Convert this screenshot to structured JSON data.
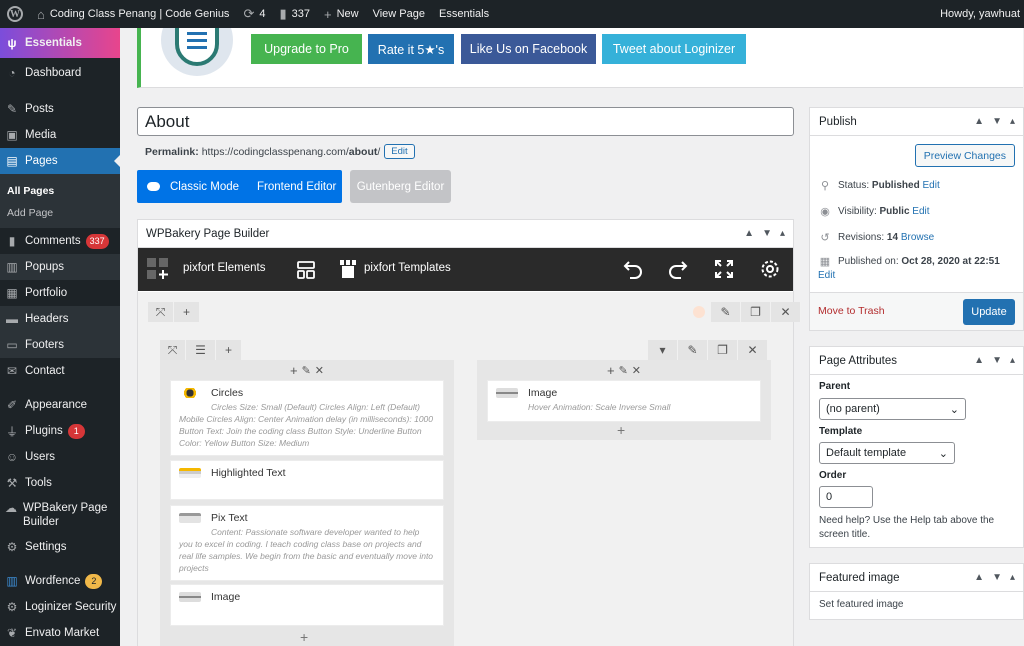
{
  "adminbar": {
    "site_name": "Coding Class Penang | Code Genius",
    "updates_count": "4",
    "comments_count": "337",
    "new_label": "New",
    "view_page_label": "View Page",
    "essentials_label": "Essentials",
    "howdy": "Howdy, yawhuat"
  },
  "sidebar": {
    "essentials": "Essentials",
    "dashboard": "Dashboard",
    "posts": "Posts",
    "media": "Media",
    "pages": "Pages",
    "all_pages": "All Pages",
    "add_page": "Add Page",
    "comments": "Comments",
    "comments_badge": "337",
    "popups": "Popups",
    "portfolio": "Portfolio",
    "headers": "Headers",
    "footers": "Footers",
    "contact": "Contact",
    "appearance": "Appearance",
    "plugins": "Plugins",
    "plugins_badge": "1",
    "users": "Users",
    "tools": "Tools",
    "wpbakery": "WPBakery Page Builder",
    "settings": "Settings",
    "wordfence": "Wordfence",
    "wordfence_badge": "2",
    "loginizer": "Loginizer Security",
    "envato": "Envato Market"
  },
  "promo": {
    "upgrade": "Upgrade to Pro",
    "rate": "Rate it 5★'s",
    "like": "Like Us on Facebook",
    "tweet": "Tweet about Loginizer"
  },
  "editor": {
    "title": "About",
    "permalink_label": "Permalink:",
    "permalink_base": "https://codingclasspenang.com/",
    "permalink_slug": "about",
    "permalink_tail": "/",
    "permalink_edit": "Edit",
    "classic_mode": "Classic Mode",
    "frontend_editor": "Frontend Editor",
    "gutenberg_editor": "Gutenberg Editor"
  },
  "wpbakery": {
    "title": "WPBakery Page Builder",
    "pixfort_elements": "pixfort Elements",
    "pixfort_templates": "pixfort Templates",
    "elements": [
      {
        "name": "Circles",
        "desc": "Circles Size: Small (Default)  Circles Align: Left (Default)  Mobile Circles Align: Center  Animation delay (in milliseconds): 1000  Button Text: Join the coding class  Button Style: Underline  Button Color: Yellow  Button Size: Medium"
      },
      {
        "name": "Highlighted Text",
        "desc": ""
      },
      {
        "name": "Pix Text",
        "desc": "Content: Passionate software developer wanted to help you to excel in coding. I teach coding class base on projects and real life samples. We begin from the basic and eventually move into projects"
      },
      {
        "name": "Image",
        "desc": ""
      },
      {
        "name": "Image",
        "desc": "Hover Animation: Scale Inverse Small"
      }
    ]
  },
  "publish": {
    "title": "Publish",
    "preview": "Preview Changes",
    "status_label": "Status:",
    "status_value": "Published",
    "visibility_label": "Visibility:",
    "visibility_value": "Public",
    "revisions_label": "Revisions:",
    "revisions_value": "14",
    "browse": "Browse",
    "published_on_label": "Published on:",
    "published_on_value": "Oct 28, 2020 at 22:51",
    "edit": "Edit",
    "trash": "Move to Trash",
    "update": "Update"
  },
  "page_attributes": {
    "title": "Page Attributes",
    "parent_label": "Parent",
    "parent_value": "(no parent)",
    "template_label": "Template",
    "template_value": "Default template",
    "order_label": "Order",
    "order_value": "0",
    "help_text": "Need help? Use the Help tab above the screen title."
  },
  "featured_image": {
    "title": "Featured image",
    "link": "Set featured image"
  },
  "colors": {
    "wp_blue": "#2271b1",
    "green": "#46b450",
    "fb_blue": "#3b5998",
    "twitter": "#35b1d9",
    "wpb_dark": "#2a2a2a"
  }
}
